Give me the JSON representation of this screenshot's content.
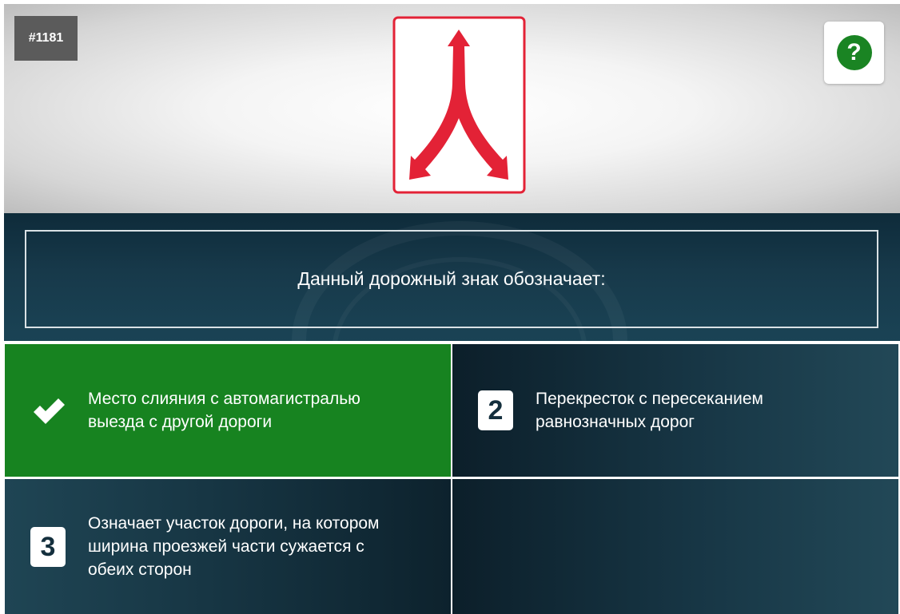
{
  "question": {
    "number": "#1181",
    "text": "Данный дорожный знак обозначает:"
  },
  "help": {
    "label": "?"
  },
  "sign": {
    "border_color": "#e32236",
    "arrow_color": "#e32236"
  },
  "answers": [
    {
      "badge": "",
      "text": "Место слияния с автомагистралью выезда с другой дороги",
      "state": "correct"
    },
    {
      "badge": "2",
      "text": "Перекресток с пересеканием равнозначных дорог",
      "state": "default"
    },
    {
      "badge": "3",
      "text": "Означает участок дороги, на котором ширина проезжей части сужается с обеих сторон",
      "state": "default"
    },
    {
      "badge": "",
      "text": "",
      "state": "empty"
    }
  ],
  "colors": {
    "correct": "#178320",
    "dark": "#173645",
    "help_green": "#1a8423"
  }
}
